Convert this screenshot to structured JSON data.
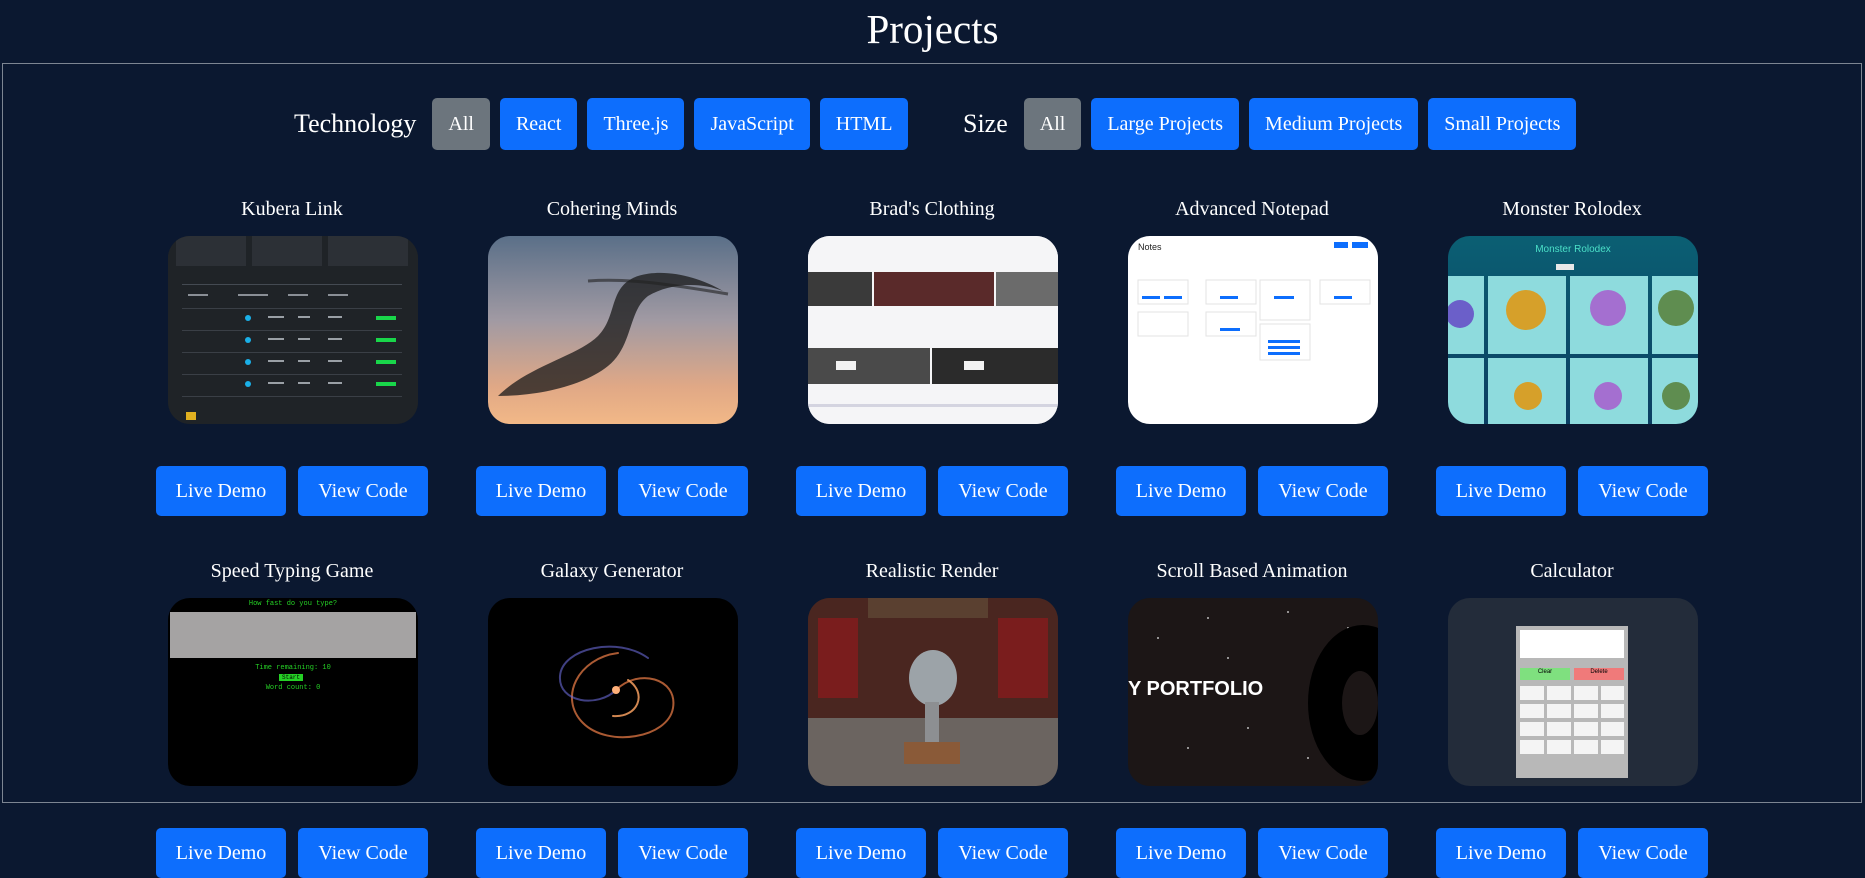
{
  "page": {
    "title": "Projects"
  },
  "filters": {
    "technology": {
      "label": "Technology",
      "options": [
        "All",
        "React",
        "Three.js",
        "JavaScript",
        "HTML"
      ],
      "active": "All"
    },
    "size": {
      "label": "Size",
      "options": [
        "All",
        "Large Projects",
        "Medium Projects",
        "Small Projects"
      ],
      "active": "All"
    }
  },
  "buttons": {
    "live_demo": "Live Demo",
    "view_code": "View Code"
  },
  "projects": [
    {
      "title": "Kubera Link"
    },
    {
      "title": "Cohering Minds"
    },
    {
      "title": "Brad's Clothing"
    },
    {
      "title": "Advanced Notepad"
    },
    {
      "title": "Monster Rolodex"
    },
    {
      "title": "Speed Typing Game"
    },
    {
      "title": "Galaxy Generator"
    },
    {
      "title": "Realistic Render"
    },
    {
      "title": "Scroll Based Animation"
    },
    {
      "title": "Calculator"
    }
  ],
  "thumb_text": {
    "notepad_heading": "Notes",
    "monster_heading": "Monster Rolodex",
    "typing_prompt": "How fast do you type?",
    "typing_time": "Time remaining: 10",
    "typing_start": "Start",
    "typing_words": "Word count: 0",
    "scroll_text": "Y PORTFOLIO",
    "calc_clear": "Clear",
    "calc_delete": "Delete"
  },
  "colors": {
    "background": "#0b1830",
    "button_primary": "#0d6efd",
    "button_active": "#6c757d",
    "text": "#ffffff"
  }
}
